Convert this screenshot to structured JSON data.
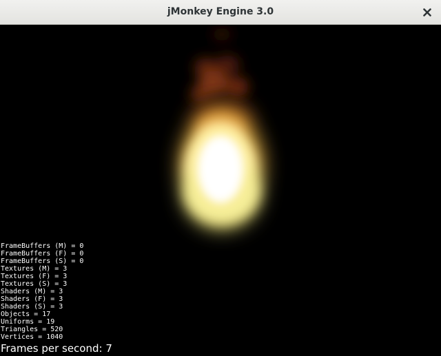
{
  "window": {
    "title": "jMonkey Engine 3.0",
    "close_icon": "close-x-icon"
  },
  "scene": {
    "background_color": "#000000",
    "effect": "fire-particle-emitter"
  },
  "stats": [
    "FrameBuffers (M) = 0",
    "FrameBuffers (F) = 0",
    "FrameBuffers (S) = 0",
    "Textures (M) = 3",
    "Textures (F) = 3",
    "Textures (S) = 3",
    "Shaders (M) = 3",
    "Shaders (F) = 3",
    "Shaders (S) = 3",
    "Objects = 17",
    "Uniforms = 19",
    "Triangles = 520",
    "Vertices = 1040"
  ],
  "fps_text": "Frames per second: 7"
}
